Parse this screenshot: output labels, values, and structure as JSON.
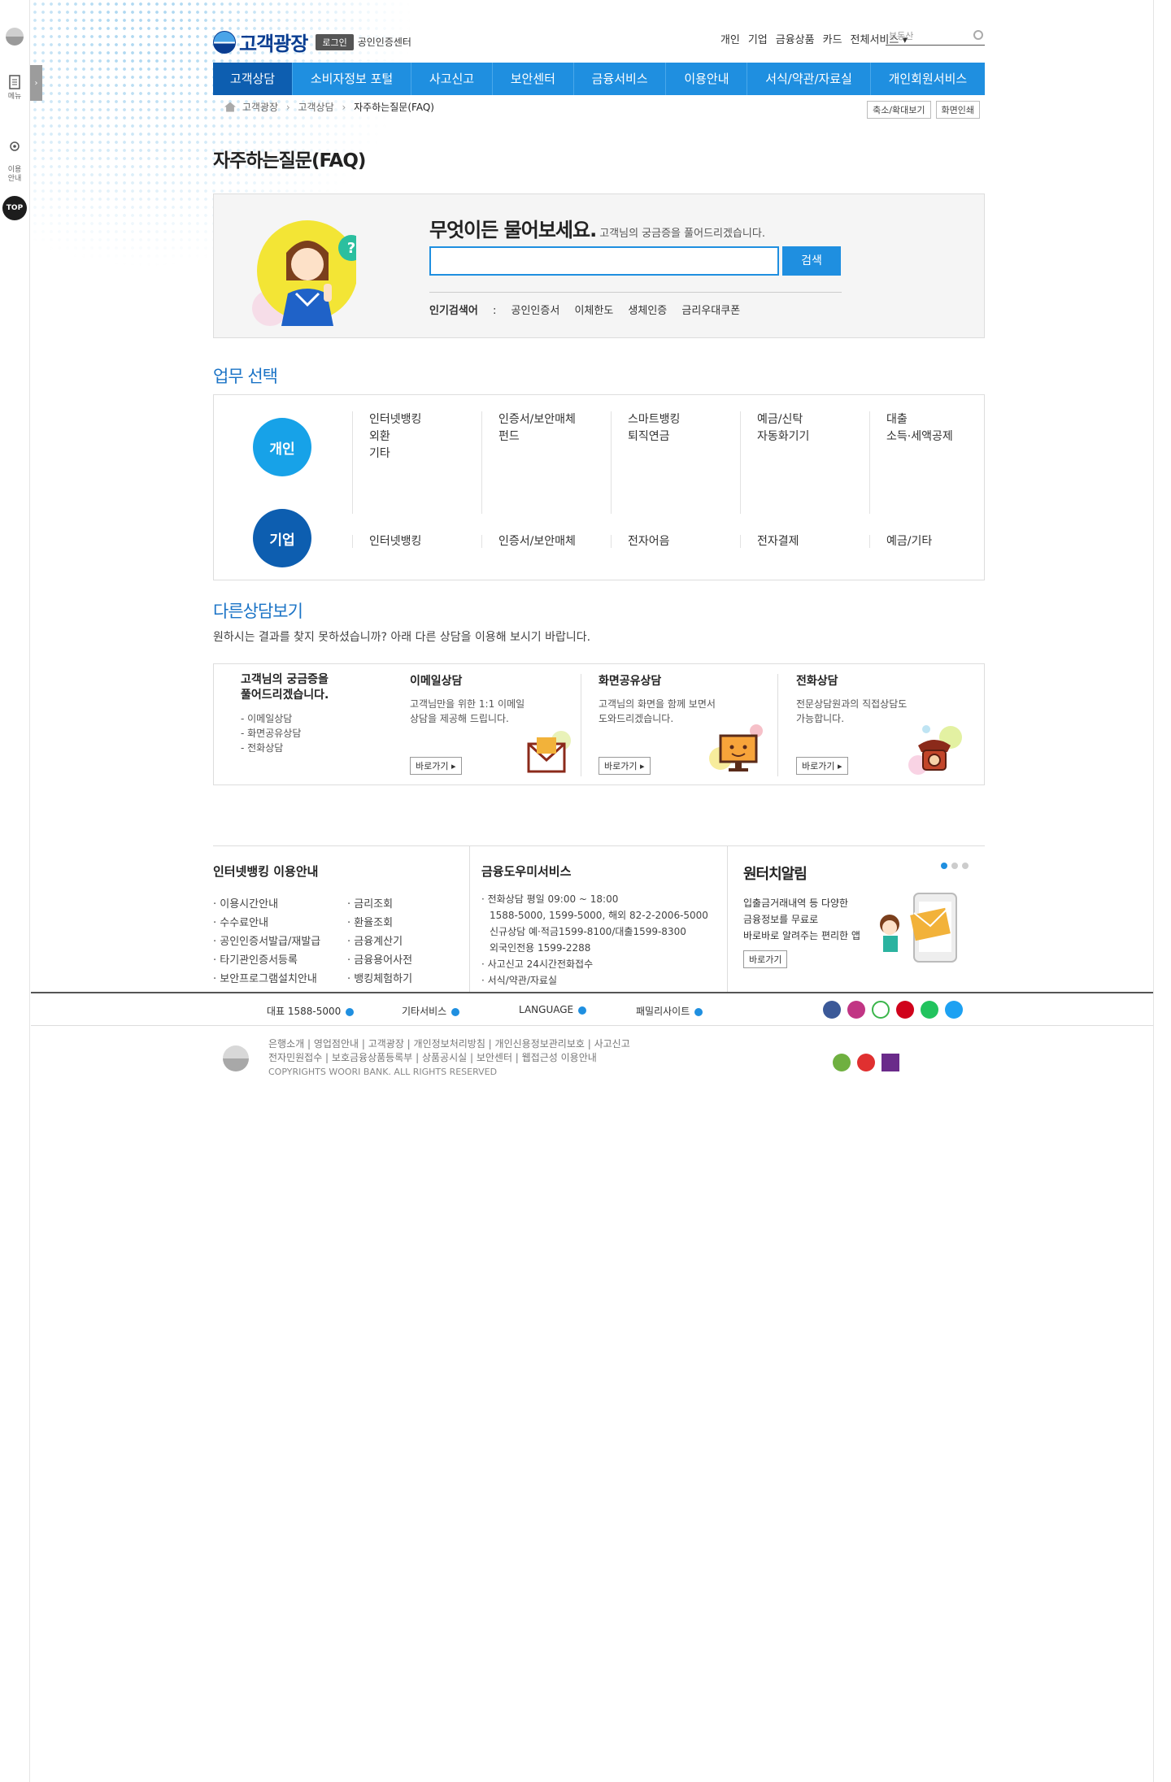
{
  "sidebar": {
    "menu_label": "메뉴",
    "guide_label": "이용\n안내",
    "top_label": "TOP",
    "tab_arrow": "›"
  },
  "header": {
    "logo_text": "고객광장",
    "login_label": "로그인",
    "cert_label": "공인인증센터",
    "util_links": [
      "개인",
      "기업",
      "금융상품",
      "카드",
      "전체서비스 ▾"
    ],
    "search_placeholder": "부동산"
  },
  "gnb": [
    "고객상담",
    "소비자정보 포털",
    "사고신고",
    "보안센터",
    "금융서비스",
    "이용안내",
    "서식/약관/자료실",
    "개인회원서비스"
  ],
  "breadcrumb": {
    "items": [
      "고객광장",
      "고객상담",
      "자주하는질문(FAQ)"
    ],
    "zoom_label": "축소/확대보기",
    "print_label": "화면인쇄"
  },
  "page_title": "자주하는질문(FAQ)",
  "faq": {
    "headline": "무엇이든 물어보세요.",
    "subline": "고객님의 궁금증을 풀어드리겠습니다.",
    "input_value": "",
    "search_label": "검색",
    "popular_label": "인기검색어",
    "popular_colon": ":",
    "popular": [
      "공인인증서",
      "이체한도",
      "생체인증",
      "금리우대쿠폰"
    ]
  },
  "biz": {
    "title": "업무 선택",
    "personal_label": "개인",
    "corp_label": "기업",
    "personal_cols": [
      [
        "인터넷뱅킹",
        "외환",
        "기타"
      ],
      [
        "인증서/보안매체",
        "펀드"
      ],
      [
        "스마트뱅킹",
        "퇴직연금"
      ],
      [
        "예금/신탁",
        "자동화기기"
      ],
      [
        "대출",
        "소득·세액공제"
      ]
    ],
    "corp_cols": [
      "인터넷뱅킹",
      "인증서/보안매체",
      "전자어음",
      "전자결제",
      "예금/기타"
    ]
  },
  "other": {
    "title": "다른상담보기",
    "desc": "원하시는 결과를 찾지 못하셨습니까? 아래 다른 상담을 이용해 보시기 바랍니다.",
    "intro_title": "고객님의 궁금증을\n풀어드리겠습니다.",
    "intro_list": [
      "- 이메일상담",
      "- 화면공유상담",
      "- 전화상담"
    ],
    "cards": [
      {
        "title": "이메일상담",
        "desc": "고객님만을 위한 1:1 이메일\n상담을 제공해 드립니다.",
        "btn": "바로가기"
      },
      {
        "title": "화면공유상담",
        "desc": "고객님의 화면을 함께 보면서\n도와드리겠습니다.",
        "btn": "바로가기"
      },
      {
        "title": "전화상담",
        "desc": "전문상담원과의 직접상담도\n가능합니다.",
        "btn": "바로가기"
      }
    ]
  },
  "info": {
    "ib_title": "인터넷뱅킹 이용안내",
    "ib_left": [
      "이용시간안내",
      "수수료안내",
      "공인인증서발급/재발급",
      "타기관인증서등록",
      "보안프로그램설치안내"
    ],
    "ib_right": [
      "금리조회",
      "환율조회",
      "금융계산기",
      "금융용어사전",
      "뱅킹체험하기"
    ],
    "help_title": "금융도우미서비스",
    "help_lines": [
      "전화상담 평일 09:00 ~ 18:00",
      "1588-5000, 1599-5000, 해외 82-2-2006-5000",
      "신규상담 예·적금1599-8100/대출1599-8300",
      "외국인전용 1599-2288"
    ],
    "help_items": [
      "사고신고 24시간전화접수",
      "서식/약관/자료실"
    ],
    "alarm_title": "원터치알림",
    "alarm_desc": "입출금거래내역 등 다양한\n금융정보를 무료로\n바로바로 알려주는 편리한 앱",
    "alarm_btn": "바로가기"
  },
  "footbar": {
    "links": [
      "대표 1588-5000",
      "기타서비스",
      "LANGUAGE",
      "패밀리사이트"
    ]
  },
  "copy": {
    "line1": "은행소개 | 영업점안내 | 고객광장 | 개인정보처리방침 | 개인신용정보관리보호 | 사고신고",
    "line2": "전자민원접수 | 보호금융상품등록부 | 상품공시실 | 보안센터 | 웹접근성 이용안내",
    "line3": "COPYRIGHTS WOORI BANK. ALL RIGHTS RESERVED"
  },
  "colors": {
    "primary": "#1f8fe0",
    "primary_dark": "#0d5eb0",
    "title_blue": "#1a73c6"
  }
}
